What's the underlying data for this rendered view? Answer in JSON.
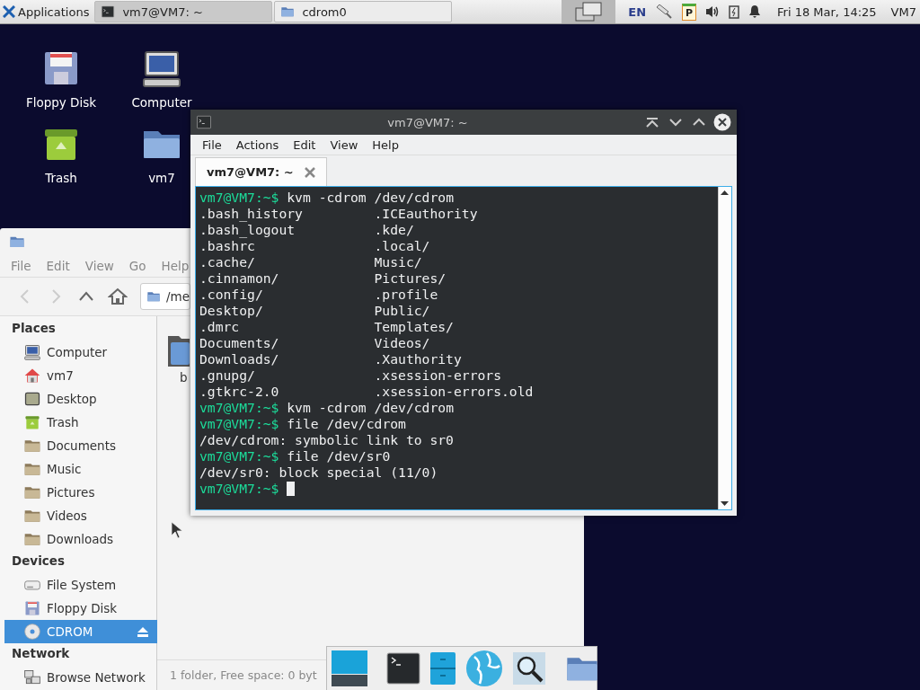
{
  "panel": {
    "apps_label": "Applications",
    "tasks": [
      {
        "label": "vm7@VM7: ~",
        "kind": "terminal",
        "selected": true
      },
      {
        "label": "cdrom0",
        "kind": "folder",
        "selected": false
      }
    ],
    "keyboard_layout": "EN",
    "clipboard_label": "P",
    "clock": "Fri 18 Mar, 14:25",
    "user": "VM7"
  },
  "desktop_icons": [
    {
      "label": "Floppy Disk",
      "kind": "floppy"
    },
    {
      "label": "Computer",
      "kind": "computer"
    },
    {
      "label": "Trash",
      "kind": "trash"
    },
    {
      "label": "vm7",
      "kind": "home"
    }
  ],
  "file_manager": {
    "menu": [
      "File",
      "Edit",
      "View",
      "Go",
      "Help"
    ],
    "location": "/me",
    "sidebar": [
      {
        "title": "Places",
        "items": [
          {
            "label": "Computer",
            "kind": "computer",
            "selected": false
          },
          {
            "label": "vm7",
            "kind": "home",
            "selected": false
          },
          {
            "label": "Desktop",
            "kind": "desktop",
            "selected": false
          },
          {
            "label": "Trash",
            "kind": "trash",
            "selected": false
          },
          {
            "label": "Documents",
            "kind": "folder",
            "selected": false
          },
          {
            "label": "Music",
            "kind": "folder",
            "selected": false
          },
          {
            "label": "Pictures",
            "kind": "folder",
            "selected": false
          },
          {
            "label": "Videos",
            "kind": "folder",
            "selected": false
          },
          {
            "label": "Downloads",
            "kind": "folder",
            "selected": false
          }
        ]
      },
      {
        "title": "Devices",
        "items": [
          {
            "label": "File System",
            "kind": "drive",
            "selected": false,
            "ejectable": false
          },
          {
            "label": "Floppy Disk",
            "kind": "floppy",
            "selected": false,
            "ejectable": false
          },
          {
            "label": "CDROM",
            "kind": "disc",
            "selected": true,
            "ejectable": true
          }
        ]
      },
      {
        "title": "Network",
        "items": [
          {
            "label": "Browse Network",
            "kind": "network",
            "selected": false
          }
        ]
      }
    ],
    "items": [
      {
        "label": "b"
      }
    ],
    "status": "1 folder, Free space: 0 byt"
  },
  "terminal": {
    "title": "vm7@VM7: ~",
    "menu": [
      "File",
      "Actions",
      "Edit",
      "View",
      "Help"
    ],
    "tabs": [
      {
        "label": "vm7@VM7: ~",
        "selected": true
      }
    ],
    "lines": [
      {
        "kind": "prompt",
        "prompt": "vm7@VM7:~$",
        "command": "kvm -cdrom /dev/cdrom"
      },
      {
        "kind": "listing",
        "left": ".bash_history",
        "right": ".ICEauthority"
      },
      {
        "kind": "listing",
        "left": ".bash_logout",
        "right": ".kde/"
      },
      {
        "kind": "listing",
        "left": ".bashrc",
        "right": ".local/"
      },
      {
        "kind": "listing",
        "left": ".cache/",
        "right": "Music/"
      },
      {
        "kind": "listing",
        "left": ".cinnamon/",
        "right": "Pictures/"
      },
      {
        "kind": "listing",
        "left": ".config/",
        "right": ".profile"
      },
      {
        "kind": "listing",
        "left": "Desktop/",
        "right": "Public/"
      },
      {
        "kind": "listing",
        "left": ".dmrc",
        "right": "Templates/"
      },
      {
        "kind": "listing",
        "left": "Documents/",
        "right": "Videos/"
      },
      {
        "kind": "listing",
        "left": "Downloads/",
        "right": ".Xauthority"
      },
      {
        "kind": "listing",
        "left": ".gnupg/",
        "right": ".xsession-errors"
      },
      {
        "kind": "listing",
        "left": ".gtkrc-2.0",
        "right": ".xsession-errors.old"
      },
      {
        "kind": "prompt",
        "prompt": "vm7@VM7:~$",
        "command": "kvm -cdrom /dev/cdrom"
      },
      {
        "kind": "prompt",
        "prompt": "vm7@VM7:~$",
        "command": "file /dev/cdrom"
      },
      {
        "kind": "output",
        "text": "/dev/cdrom: symbolic link to sr0"
      },
      {
        "kind": "prompt",
        "prompt": "vm7@VM7:~$",
        "command": "file /dev/sr0"
      },
      {
        "kind": "output",
        "text": "/dev/sr0: block special (11/0)"
      },
      {
        "kind": "prompt",
        "prompt": "vm7@VM7:~$",
        "cursor": true
      }
    ]
  }
}
